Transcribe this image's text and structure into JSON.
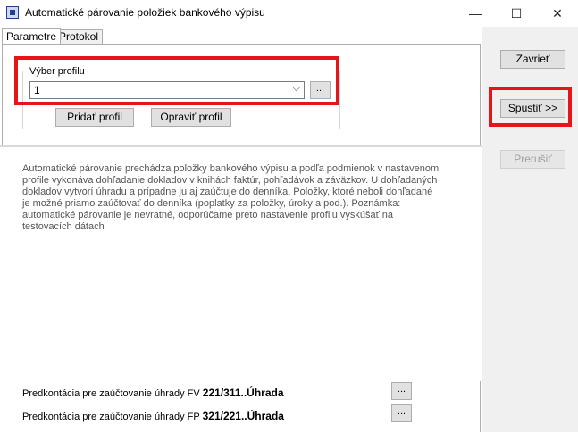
{
  "window": {
    "title": "Automatické párovanie položiek bankového výpisu",
    "minimize_glyph": "—",
    "maximize_glyph": "☐",
    "close_glyph": "✕"
  },
  "tabs": [
    {
      "label": "Parametre",
      "active": true
    },
    {
      "label": "Protokol",
      "active": false
    }
  ],
  "profile": {
    "group_label": "Výber profilu",
    "selected": "1",
    "dropdown_glyph": "⌵",
    "browse_label": "...",
    "add_label": "Pridať profil",
    "edit_label": "Opraviť profil"
  },
  "sidebar": {
    "close_label": "Zavrieť",
    "run_label": "Spustiť >>",
    "interrupt_label": "Prerušiť"
  },
  "description": "Automatické párovanie prechádza položky bankového výpisu a podľa podmienok v nastavenom profile vykonáva dohľadanie dokladov v knihách faktúr, pohľadávok a záväzkov. U dohľadaných dokladov vytvorí úhradu a prípadne ju aj zaúčtuje do denníka. Položky, ktoré neboli dohľadané je možné priamo zaúčtovať do denníka (poplatky za položky, úroky a pod.). Poznámka: automatické párovanie je nevratné, odporúčame preto nastavenie profilu vyskúšať na testovacích dátach",
  "predkontacie": [
    {
      "label": "Predkontácia pre zaúčtovanie úhrady FV",
      "value": "221/311..Úhrada",
      "browse_label": "..."
    },
    {
      "label": "Predkontácia pre zaúčtovanie úhrady FP",
      "value": "321/221..Úhrada",
      "browse_label": "..."
    }
  ],
  "colors": {
    "highlight": "#e8141c",
    "panel": "#f0f0f0"
  }
}
